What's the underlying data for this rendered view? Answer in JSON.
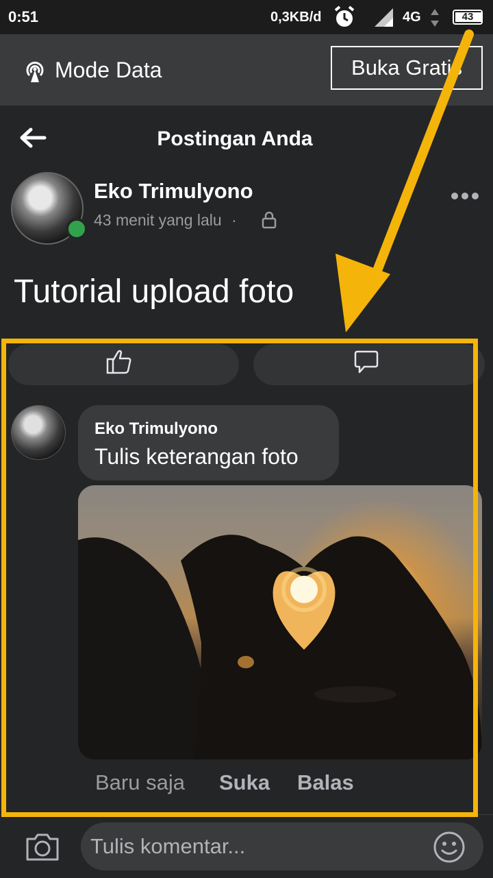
{
  "status_bar": {
    "time": "0:51",
    "speed": "0,3KB/d",
    "network": "4G",
    "battery": "43",
    "icons": [
      "alarm-icon",
      "signal-icon",
      "data-arrows-icon",
      "battery-icon"
    ]
  },
  "mode_bar": {
    "label": "Mode Data",
    "button": "Buka Gratis",
    "icon": "broadcast-icon"
  },
  "header": {
    "title": "Postingan Anda",
    "back_icon": "back-arrow-icon"
  },
  "post": {
    "author": "Eko Trimulyono",
    "time": "43 menit yang lalu",
    "separator": "·",
    "privacy_icon": "lock-icon",
    "more_icon": "more-icon",
    "text": "Tutorial upload foto",
    "online": true
  },
  "reactions": {
    "like_icon": "thumbs-up-icon",
    "comment_icon": "comment-icon"
  },
  "comment": {
    "author": "Eko Trimulyono",
    "text": "Tulis keterangan foto",
    "photo": "heart-hands-sunset-photo",
    "time": "Baru saja",
    "like_label": "Suka",
    "reply_label": "Balas"
  },
  "composer": {
    "placeholder": "Tulis komentar...",
    "camera_icon": "camera-icon",
    "emoji_icon": "emoji-icon"
  },
  "annotation": {
    "color": "#f5b40a"
  }
}
